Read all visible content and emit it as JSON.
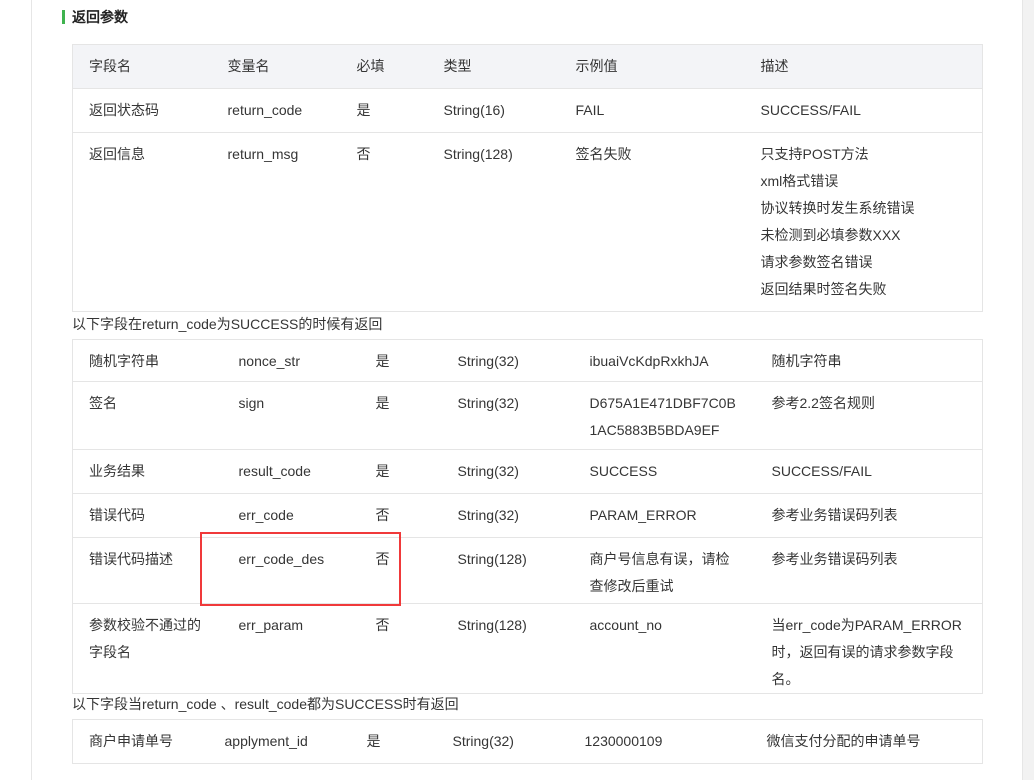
{
  "section_title": "返回参数",
  "table1": {
    "headers": [
      "字段名",
      "变量名",
      "必填",
      "类型",
      "示例值",
      "描述"
    ],
    "rows": [
      [
        "返回状态码",
        "return_code",
        "是",
        "String(16)",
        "FAIL",
        [
          "SUCCESS/FAIL"
        ]
      ],
      [
        "返回信息",
        "return_msg",
        "否",
        "String(128)",
        "签名失败",
        [
          "只支持POST方法",
          "xml格式错误",
          "协议转换时发生系统错误",
          "未检测到必填参数XXX",
          "请求参数签名错误",
          "返回结果时签名失败"
        ]
      ]
    ]
  },
  "note1": "以下字段在return_code为SUCCESS的时候有返回",
  "table2": {
    "rows": [
      [
        [
          "随机字符串"
        ],
        "nonce_str",
        "是",
        "String(32)",
        [
          "ibuaiVcKdpRxkhJA"
        ],
        [
          "随机字符串"
        ]
      ],
      [
        [
          "签名"
        ],
        "sign",
        "是",
        "String(32)",
        [
          "D675A1E471DBF7C0B",
          "1AC5883B5BDA9EF"
        ],
        [
          "参考2.2签名规则"
        ]
      ],
      [
        [
          "业务结果"
        ],
        "result_code",
        "是",
        "String(32)",
        [
          "SUCCESS"
        ],
        [
          "SUCCESS/FAIL"
        ]
      ],
      [
        [
          "错误代码"
        ],
        "err_code",
        "否",
        "String(32)",
        [
          "PARAM_ERROR"
        ],
        [
          "参考业务错误码列表"
        ]
      ],
      [
        [
          "错误代码描述"
        ],
        "err_code_des",
        "否",
        "String(128)",
        [
          "商户号信息有误，请检",
          "查修改后重试"
        ],
        [
          "参考业务错误码列表"
        ]
      ],
      [
        [
          "参数校验不通过的",
          "字段名"
        ],
        "err_param",
        "否",
        "String(128)",
        [
          "account_no"
        ],
        [
          "当err_code为PARAM_ERROR",
          "时，返回有误的请求参数字段",
          "名。"
        ]
      ]
    ]
  },
  "note2": "以下字段当return_code 、result_code都为SUCCESS时有返回",
  "table3": {
    "rows": [
      [
        "商户申请单号",
        "applyment_id",
        "是",
        "String(32)",
        "1230000109",
        "微信支付分配的申请单号"
      ]
    ]
  },
  "colors": {
    "accent": "#3fb34f",
    "highlight": "#f0393a",
    "header_bg": "#f3f4f7"
  }
}
